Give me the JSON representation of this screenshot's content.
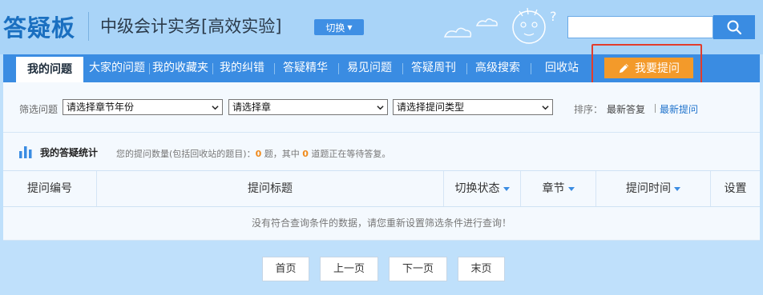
{
  "header": {
    "logo": "答疑板",
    "course_title": "中级会计实务[高效实验]",
    "switch_label": "切换",
    "search": {
      "value": "",
      "placeholder": ""
    }
  },
  "nav": {
    "items": [
      {
        "label": "我的问题"
      },
      {
        "label": "大家的问题"
      },
      {
        "label": "我的收藏夹"
      },
      {
        "label": "我的纠错"
      },
      {
        "label": "答疑精华"
      },
      {
        "label": "易见问题"
      },
      {
        "label": "答疑周刊"
      },
      {
        "label": "高级搜索"
      },
      {
        "label": "回收站"
      }
    ],
    "ask_label": "我要提问"
  },
  "filter": {
    "label": "筛选问题",
    "selects": [
      {
        "value": "请选择章节年份"
      },
      {
        "value": "请选择章"
      },
      {
        "value": "请选择提问类型"
      }
    ],
    "sort_label": "排序：",
    "sort_options": [
      "最新答复",
      "最新提问"
    ],
    "sort_active": "最新提问"
  },
  "stats": {
    "title": "我的答疑统计",
    "text_before": "您的提问数量(包括回收站的题目)：",
    "count_total": "0",
    "text_mid": " 题，其中 ",
    "count_waiting": "0",
    "text_after": " 道题正在等待答复。"
  },
  "table": {
    "headers": [
      "提问编号",
      "提问标题",
      "切换状态",
      "章节",
      "提问时间",
      "设置"
    ],
    "empty_message": "没有符合查询条件的数据，请您重新设置筛选条件进行查询！"
  },
  "pager": {
    "first": "首页",
    "prev": "上一页",
    "next": "下一页",
    "last": "末页"
  },
  "colors": {
    "nav_blue": "#3a8ce2",
    "ask_orange": "#f39a2a",
    "highlight_red": "#e23c2c",
    "logo_blue": "#1a6fc0"
  }
}
